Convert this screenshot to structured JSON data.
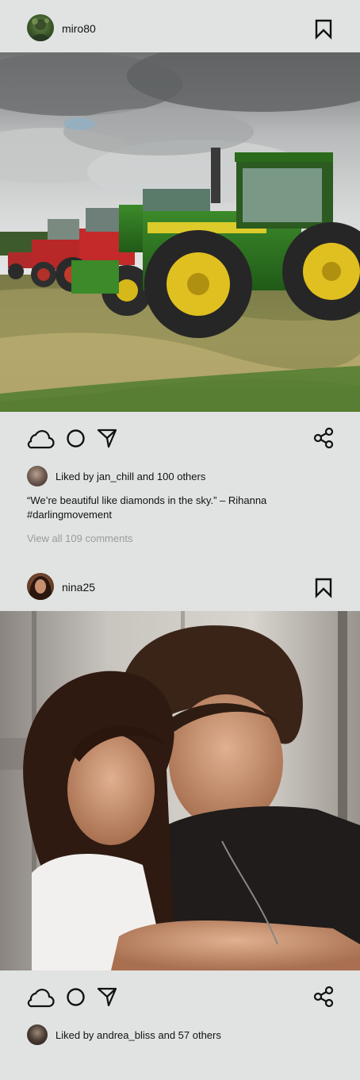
{
  "posts": [
    {
      "username": "miro80",
      "liked_by": "Liked by jan_chill and 100 others",
      "caption": "“We’re beautiful like diamonds in the sky.” – Rihanna",
      "hashtag": "#darlingmovement",
      "view_comments": "View all 109 comments",
      "photo": "tractors-in-field"
    },
    {
      "username": "nina25",
      "liked_by": "Liked by andrea_bliss and 57 others",
      "photo": "couple-embracing"
    }
  ],
  "icons": {
    "bookmark": "bookmark-icon",
    "like": "cloud-icon",
    "comment": "circle-icon",
    "send": "send-icon",
    "share": "share-icon"
  },
  "colors": {
    "background": "#e1e3e2",
    "text": "#111111",
    "muted": "#9a9c9c"
  }
}
